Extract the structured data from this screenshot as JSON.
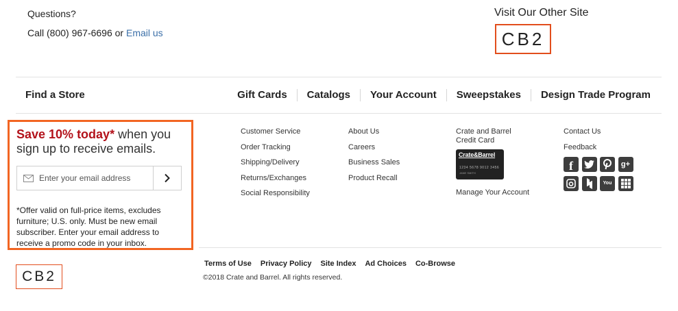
{
  "contact": {
    "questions": "Questions?",
    "call_prefix": "Call (800) 967-6696 or ",
    "email_us": "Email us"
  },
  "other_site": {
    "title": "Visit Our Other Site",
    "logo_text": "CB2"
  },
  "nav": {
    "find_store": "Find a Store",
    "items": [
      "Gift Cards",
      "Catalogs",
      "Your Account",
      "Sweepstakes",
      "Design Trade Program"
    ]
  },
  "signup": {
    "save": "Save 10% today*",
    "rest": " when you sign up to receive emails.",
    "placeholder": "Enter your email address",
    "offer": "*Offer valid on full-price items, excludes furniture; U.S. only. Must be new email subscriber. Enter your email address to receive a promo code in your inbox.",
    "accent_color": "#f26522",
    "save_color": "#b3121b"
  },
  "columns": {
    "col1": [
      "Customer Service",
      "Order Tracking",
      "Shipping/Delivery",
      "Returns/Exchanges",
      "Social Responsibility"
    ],
    "col2": [
      "About Us",
      "Careers",
      "Business Sales",
      "Product Recall"
    ],
    "credit_card": {
      "title": "Crate and Barrel Credit Card",
      "card_brand": "Crate&Barrel",
      "card_number": "1234 5678 9012 3456",
      "card_name": "JANE SMITH",
      "manage": "Manage Your Account"
    },
    "col4": [
      "Contact Us",
      "Feedback"
    ]
  },
  "social": {
    "row1": [
      "facebook-icon",
      "twitter-icon",
      "pinterest-icon",
      "google-plus-icon"
    ],
    "row2": [
      "instagram-icon",
      "houzz-icon",
      "youtube-icon",
      "more-apps-icon"
    ],
    "glyphs": {
      "facebook": "f",
      "google": "g+",
      "youtube": "You"
    }
  },
  "footer": {
    "logo_text": "CB2",
    "links": [
      "Terms of Use",
      "Privacy Policy",
      "Site Index",
      "Ad Choices",
      "Co-Browse"
    ],
    "copyright": "©2018 Crate and Barrel. All rights reserved."
  }
}
